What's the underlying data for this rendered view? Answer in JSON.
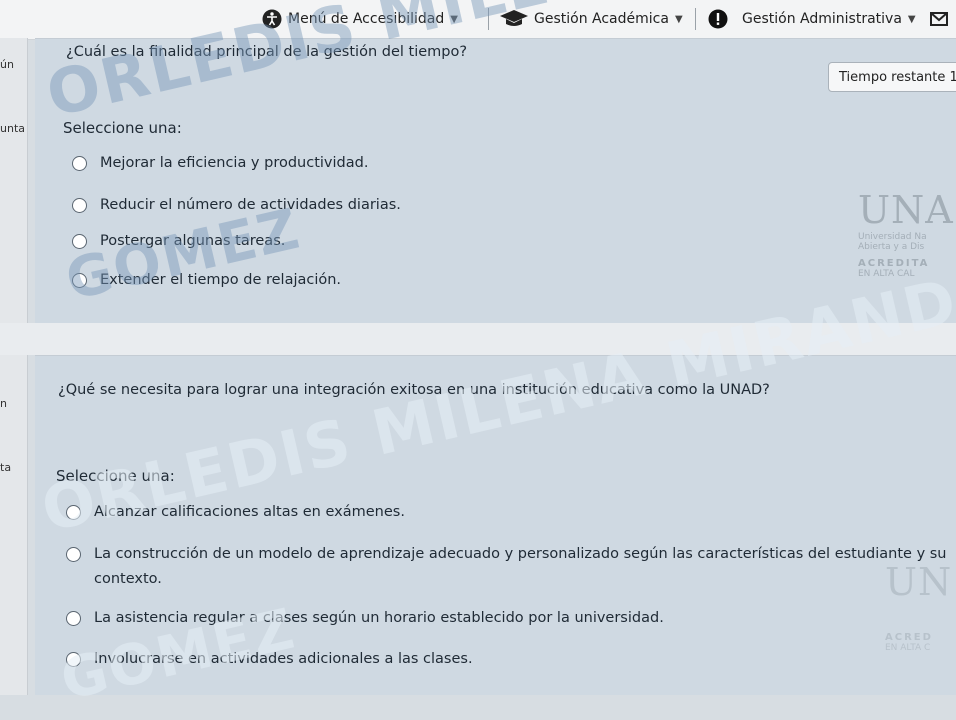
{
  "topbar": {
    "accessibility": {
      "label": "Menú de Accesibilidad",
      "icon": "accessibility-icon"
    },
    "academic": {
      "label": "Gestión Académica",
      "icon": "graduation-cap-icon"
    },
    "administrative": {
      "label": "Gestión Administrativa",
      "icon": "alert-icon"
    },
    "mail_icon": "mail-icon"
  },
  "timer": {
    "label": "Tiempo restante 1"
  },
  "question1": {
    "side_top": "ún",
    "side_mid": "unta",
    "text": "¿Cuál es la finalidad principal de la gestión del tiempo?",
    "prompt": "Seleccione una:",
    "options": [
      "Mejorar la eficiencia y productividad.",
      "Reducir el número de actividades diarias.",
      "Postergar algunas tareas.",
      "Extender el tiempo de relajación."
    ]
  },
  "question2": {
    "side_top": "n",
    "side_mid": "ta",
    "text": "¿Qué se necesita para lograr una integración exitosa en una institución educativa como la UNAD?",
    "prompt": "Seleccione una:",
    "options": [
      "Alcanzar calificaciones altas en exámenes.",
      "La construcción de un modelo de aprendizaje adecuado y personalizado según las características del estudiante y su",
      "contexto.",
      "La asistencia regular a clases según un horario establecido por la universidad.",
      "Involucrarse en actividades adicionales a las clases."
    ]
  },
  "watermark": {
    "line1": "ORLEDIS MILENA MIRANDA",
    "line2": "GOMEZ"
  },
  "logo": {
    "letters": "UNA",
    "sub1": "Universidad Na",
    "sub2": "Abierta y a Dis",
    "acr": "ACREDITA",
    "acr_sub": "EN ALTA CAL",
    "letters2": "UN",
    "acr2": "ACRED",
    "acr2_sub": "EN ALTA C"
  }
}
